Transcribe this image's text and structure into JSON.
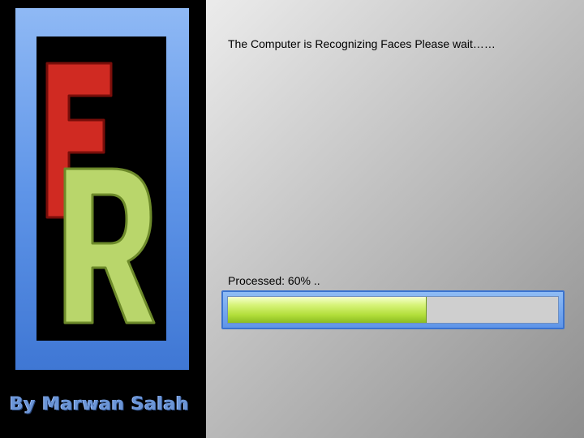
{
  "brand": {
    "logo_letters": [
      "F",
      "R"
    ],
    "credit": "By Marwan Salah"
  },
  "status": {
    "message": "The Computer is Recognizing Faces Please wait……"
  },
  "progress": {
    "label": "Processed: 60% ..",
    "value_percent": 60
  },
  "colors": {
    "frame_blue": "#5f95e8",
    "letter_f_red": "#d02a22",
    "letter_r_green": "#b9d66b",
    "progress_green": "#b2de3a"
  }
}
